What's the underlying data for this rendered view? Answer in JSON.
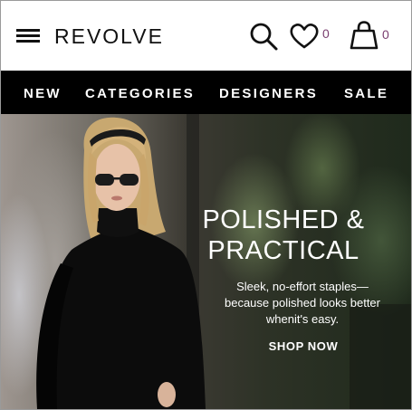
{
  "header": {
    "logo": "REVOLVE",
    "wishlist_count": "0",
    "bag_count": "0",
    "icons": [
      "menu-icon",
      "search-icon",
      "heart-icon",
      "shopping-bag-icon"
    ]
  },
  "nav": {
    "items": [
      {
        "label": "NEW"
      },
      {
        "label": "CATEGORIES"
      },
      {
        "label": "DESIGNERS"
      },
      {
        "label": "SALE"
      }
    ]
  },
  "hero": {
    "title_line1": "POLISHED &",
    "title_line2": "PRACTICAL",
    "subtitle_line1": "Sleek, no-effort staples—",
    "subtitle_line2": "because polished looks better",
    "subtitle_line3": "whenit's easy.",
    "cta": "SHOP NOW"
  },
  "colors": {
    "nav_bg": "#000000",
    "count_color": "#7a3e6f",
    "text_dark": "#111111",
    "hero_text": "#ffffff"
  }
}
